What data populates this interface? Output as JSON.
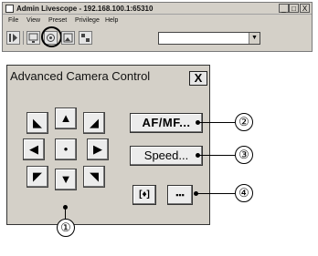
{
  "app_window": {
    "title": "Admin Livescope - 192.168.100.1:65310",
    "minimize_glyph": "_",
    "maximize_glyph": "□",
    "close_glyph": "X",
    "menu": [
      "File",
      "View",
      "Preset",
      "Privilege",
      "Help"
    ],
    "toolbar_icons": [
      "play-icon",
      "monitor-icon",
      "camera-control-icon",
      "image-icon",
      "settings-icon"
    ],
    "preset_dropdown_value": "",
    "preset_dropdown_arrow": "▼"
  },
  "dialog": {
    "title": "Advanced Camera Control",
    "close_glyph": "X",
    "arrows": {
      "up_left": "◣",
      "up": "▲",
      "up_right": "◢",
      "left": "◀",
      "center": "•",
      "right": "▶",
      "down_left": "◤",
      "down": "▼",
      "down_right": "◥"
    },
    "af_mf_label": "AF/MF...",
    "speed_label": "Speed...",
    "focus_icon_glyph": "[♦]",
    "preset_icon_glyph": "▪▪▪"
  },
  "callouts": {
    "c1": "①",
    "c2": "②",
    "c3": "③",
    "c4": "④"
  }
}
